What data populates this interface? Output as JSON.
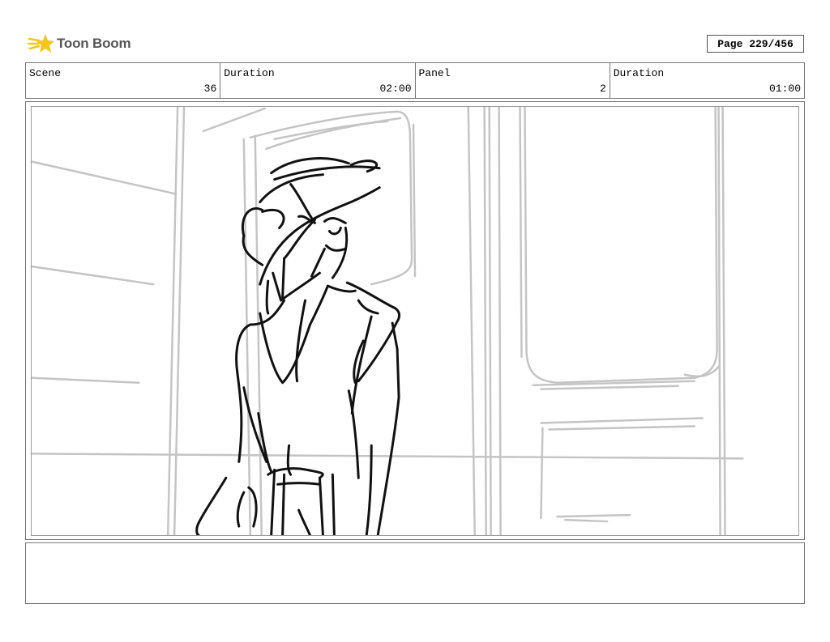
{
  "header": {
    "logo_text": "Toon Boom",
    "page_indicator": "Page 229/456"
  },
  "info": {
    "scene_label": "Scene",
    "scene_value": "36",
    "duration1_label": "Duration",
    "duration1_value": "02:00",
    "panel_label": "Panel",
    "panel_value": "2",
    "duration2_label": "Duration",
    "duration2_value": "01:00"
  },
  "notes": {
    "text": ""
  },
  "colors": {
    "logo_yellow": "#f5c518",
    "sketch_grey": "#c4c4c4",
    "sketch_black": "#111111"
  }
}
